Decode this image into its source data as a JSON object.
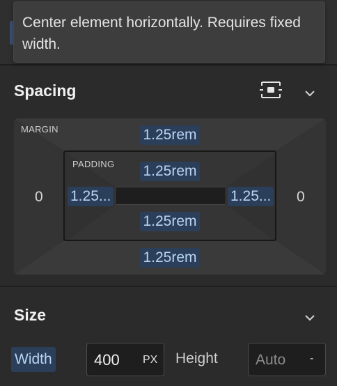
{
  "tooltip": {
    "text": "Center element horizontally. Requires fixed width."
  },
  "spacing": {
    "title": "Spacing",
    "margin_label": "MARGIN",
    "padding_label": "PADDING",
    "margin": {
      "top": "1.25rem",
      "right": "0",
      "bottom": "1.25rem",
      "left": "0"
    },
    "padding": {
      "top": "1.25rem",
      "right": "1.25...",
      "bottom": "1.25rem",
      "left": "1.25..."
    }
  },
  "size": {
    "title": "Size",
    "width_label": "Width",
    "width_value": "400",
    "width_unit": "PX",
    "height_label": "Height",
    "height_value": "Auto",
    "height_unit": "-"
  },
  "icons": {
    "center_horizontal": "center-horizontal-icon",
    "collapse": "chevron-down-icon"
  },
  "colors": {
    "background": "#2b2b2b",
    "value_chip": "#2b3f5a",
    "value_text": "#b9d3f3"
  }
}
